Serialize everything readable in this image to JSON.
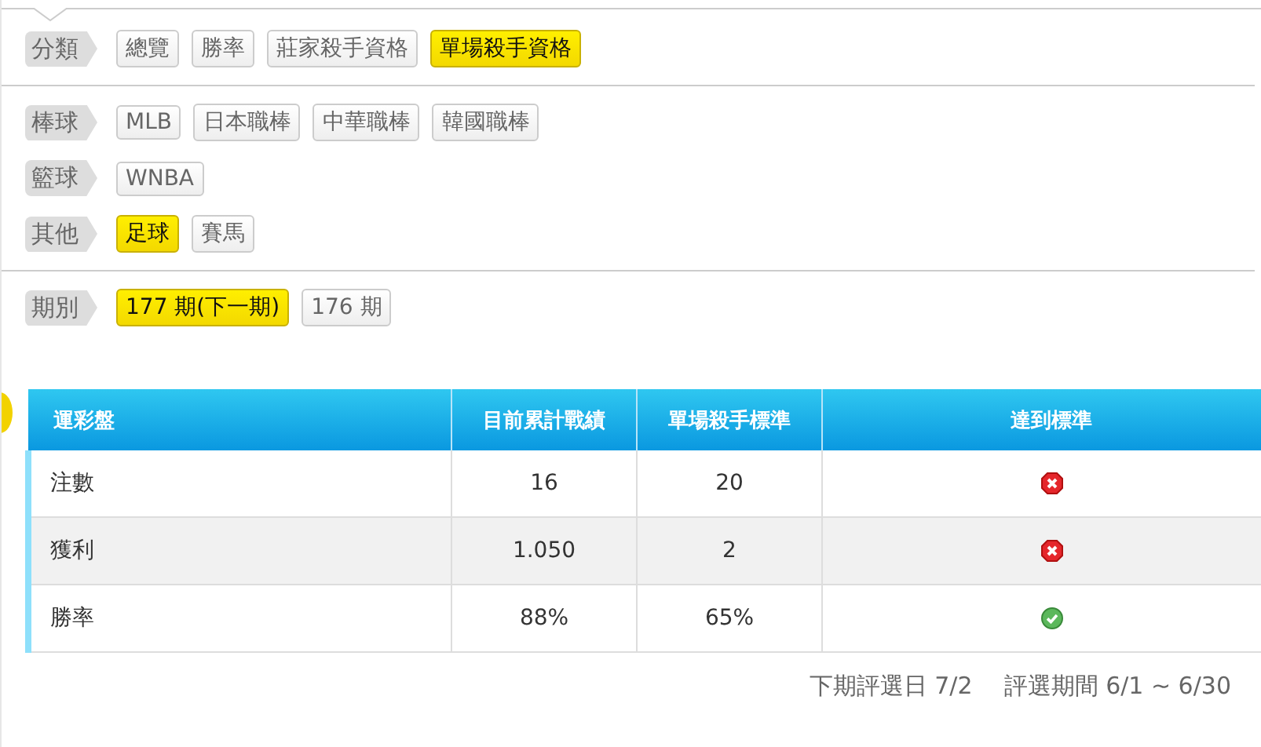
{
  "filter_sections": [
    [
      {
        "label": "分類",
        "options": [
          {
            "text": "總覽",
            "selected": false
          },
          {
            "text": "勝率",
            "selected": false
          },
          {
            "text": "莊家殺手資格",
            "selected": false
          },
          {
            "text": "單場殺手資格",
            "selected": true
          }
        ]
      }
    ],
    [
      {
        "label": "棒球",
        "options": [
          {
            "text": "MLB",
            "selected": false
          },
          {
            "text": "日本職棒",
            "selected": false
          },
          {
            "text": "中華職棒",
            "selected": false
          },
          {
            "text": "韓國職棒",
            "selected": false
          }
        ]
      },
      {
        "label": "籃球",
        "options": [
          {
            "text": "WNBA",
            "selected": false
          }
        ]
      },
      {
        "label": "其他",
        "options": [
          {
            "text": "足球",
            "selected": true
          },
          {
            "text": "賽馬",
            "selected": false
          }
        ]
      }
    ],
    [
      {
        "label": "期別",
        "options": [
          {
            "text": "177 期(下一期)",
            "selected": true
          },
          {
            "text": "176 期",
            "selected": false
          }
        ]
      }
    ]
  ],
  "table": {
    "columns": [
      "運彩盤",
      "目前累計戰績",
      "單場殺手標準",
      "達到標準"
    ],
    "rows": [
      {
        "name": "注數",
        "current": "16",
        "standard": "20",
        "met": false
      },
      {
        "name": "獲利",
        "current": "1.050",
        "standard": "2",
        "met": false
      },
      {
        "name": "勝率",
        "current": "88%",
        "standard": "65%",
        "met": true
      }
    ]
  },
  "footer": {
    "next_date": "下期評選日 7/2",
    "period": "評選期間 6/1 ~ 6/30"
  }
}
